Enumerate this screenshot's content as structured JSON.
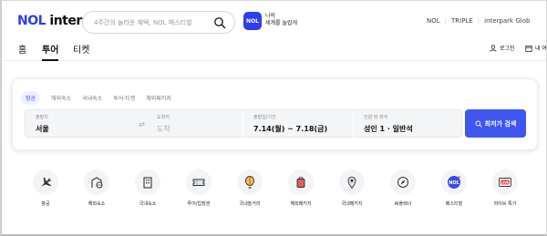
{
  "header": {
    "logo_nol": "NOL",
    "logo_interpark": " interpark",
    "search_placeholder": "4주간의 놀라운 혜택, NOL 페스티벌",
    "promo_badge": "NOL",
    "promo_line1": "나의",
    "promo_line2": "세계를 놀랍게",
    "brand_links": [
      "NOL",
      "TRIPLE",
      "interpark Glob"
    ]
  },
  "nav": {
    "tabs": [
      "홈",
      "투어",
      "티켓"
    ],
    "active_tab": "투어",
    "login_label": "로그인",
    "mytrip_label": "내 여"
  },
  "booking": {
    "tabs": [
      "항공",
      "해외숙소",
      "국내숙소",
      "투어·티켓",
      "해외패키지"
    ],
    "active_tab": "항공",
    "departure": {
      "label": "출발지",
      "value": "서울"
    },
    "arrival": {
      "label": "도착지",
      "placeholder": "도착"
    },
    "dates": {
      "label": "출발일/기간",
      "value": "7.14(월) ~ 7.18(금)"
    },
    "passengers": {
      "label": "인원 및 좌석",
      "value": "성인 1 · 일반석"
    },
    "submit_label": "최저가 검색"
  },
  "categories": [
    {
      "label": "항공",
      "icon": "airplane-icon"
    },
    {
      "label": "해외숙소",
      "icon": "global-hotel-icon"
    },
    {
      "label": "국내숙소",
      "icon": "building-icon"
    },
    {
      "label": "투어/입장권",
      "icon": "ticket-icon"
    },
    {
      "label": "국내놀거리",
      "icon": "hot-air-balloon-icon"
    },
    {
      "label": "해외패키지",
      "icon": "suitcase-icon"
    },
    {
      "label": "국내패키지",
      "icon": "location-pin-icon"
    },
    {
      "label": "AI플래너",
      "icon": "compass-icon"
    },
    {
      "label": "페스티벌",
      "icon": "nol-festival-icon"
    },
    {
      "label": "라이브 특가",
      "icon": "live-tv-icon"
    }
  ],
  "colors": {
    "brand_blue": "#2d3df0",
    "button_blue": "#4056f0"
  }
}
